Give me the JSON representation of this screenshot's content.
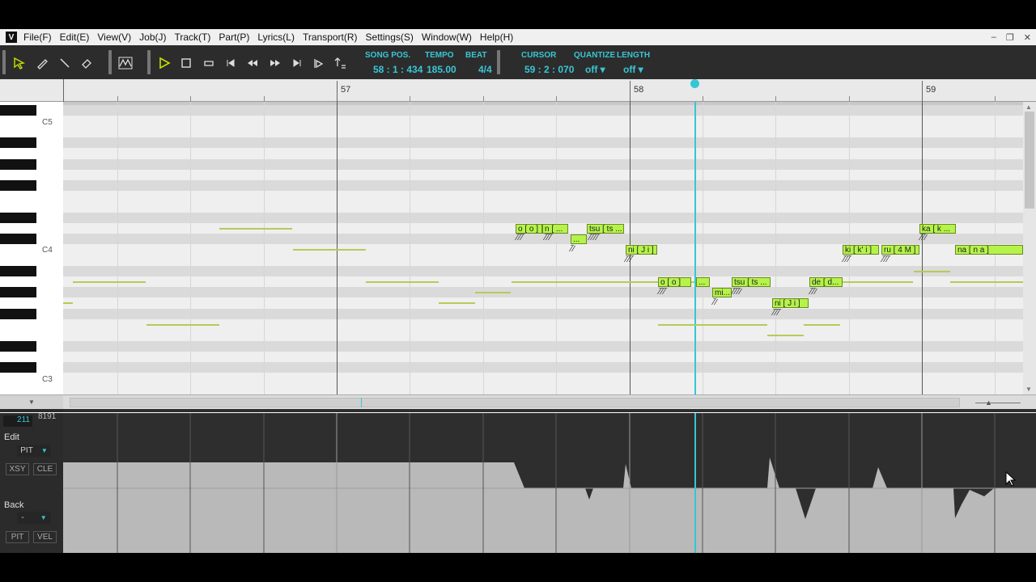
{
  "menu": {
    "items": [
      "File(F)",
      "Edit(E)",
      "View(V)",
      "Job(J)",
      "Track(T)",
      "Part(P)",
      "Lyrics(L)",
      "Transport(R)",
      "Settings(S)",
      "Window(W)",
      "Help(H)"
    ],
    "logo": "V"
  },
  "toolbar": {
    "song_pos_label": "SONG POS.",
    "song_pos_value": "58 : 1 : 434",
    "tempo_label": "TEMPO",
    "tempo_value": "185.00",
    "beat_label": "BEAT",
    "beat_value": "4/4",
    "cursor_label": "CURSOR",
    "cursor_value": "59 : 2 : 070",
    "quantize_label": "QUANTIZE",
    "quantize_value": "off ▾",
    "length_label": "LENGTH",
    "length_value": "off ▾",
    "accent_color": "#39c6d6"
  },
  "ruler": {
    "measures": [
      "57",
      "58",
      "59"
    ]
  },
  "keyboard": {
    "labels": [
      "C5",
      "C4",
      "C3"
    ]
  },
  "notes": [
    {
      "lyric": "o [ o ]"
    },
    {
      "lyric": "n [ ..."
    },
    {
      "lyric": "..."
    },
    {
      "lyric": "tsu [ ts ..."
    },
    {
      "lyric": "ni [ J i ]"
    },
    {
      "lyric": "o [ o ]"
    },
    {
      "lyric": "..."
    },
    {
      "lyric": "mi..."
    },
    {
      "lyric": "tsu [ ts ..."
    },
    {
      "lyric": "ni [ J i ]"
    },
    {
      "lyric": "de [ d..."
    },
    {
      "lyric": "ki [ k' i ]"
    },
    {
      "lyric": "ru [ 4 M ]"
    },
    {
      "lyric": "ka [ k ..."
    },
    {
      "lyric": "na [ n a ]"
    }
  ],
  "control": {
    "value_left": "211",
    "value_right": "8191",
    "edit_label": "Edit",
    "edit_param": "PIT",
    "btn_xsy": "XSY",
    "btn_cle": "CLE",
    "back_label": "Back",
    "back_param": "-",
    "btn_pit": "PIT",
    "btn_vel": "VEL"
  },
  "colors": {
    "note_fill": "#b5f34a",
    "playhead": "#35c6d6",
    "ghost_note": "#b4cc59"
  }
}
